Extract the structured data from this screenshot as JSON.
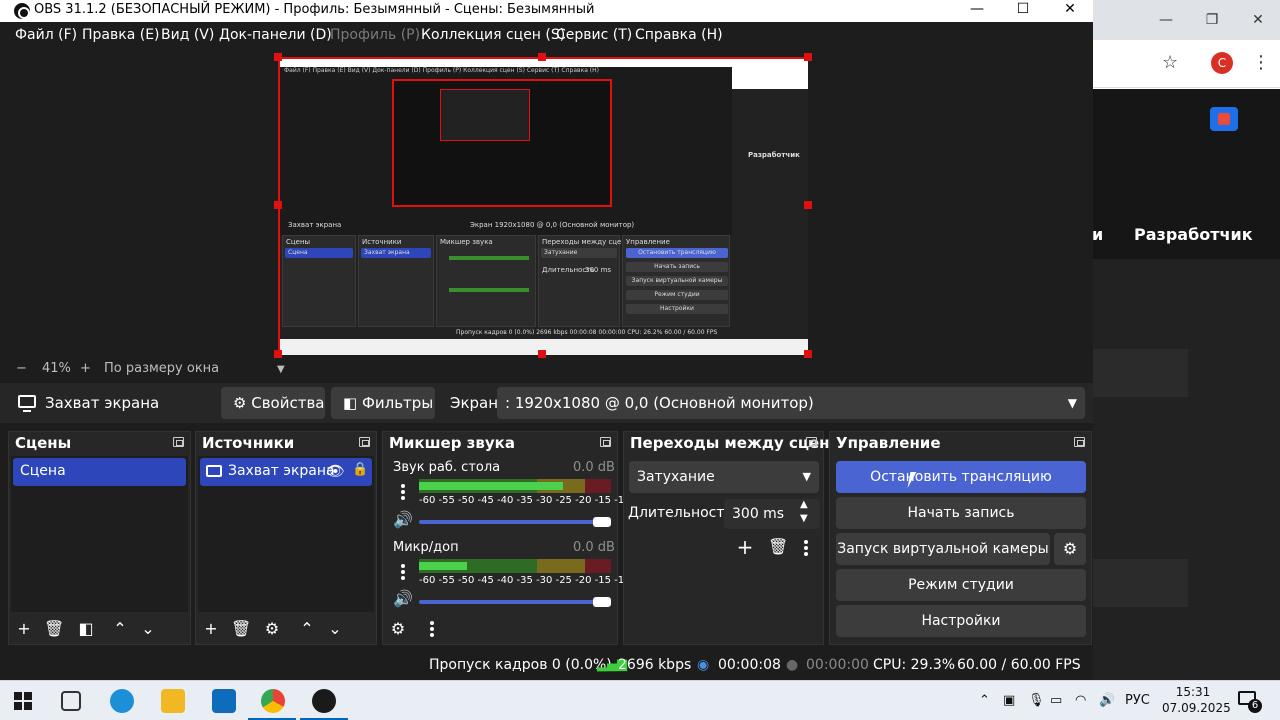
{
  "window": {
    "title": "OBS 31.1.2 (БЕЗОПАСНЫЙ РЕЖИМ) - Профиль: Безымянный - Сцены: Безымянный",
    "minimize": "—",
    "maximize": "☐",
    "close": "✕"
  },
  "menu": [
    {
      "label": "Файл (F)"
    },
    {
      "label": "Правка (E)"
    },
    {
      "label": "Вид (V)"
    },
    {
      "label": "Док-панели (D)"
    },
    {
      "label": "Профиль (P)"
    },
    {
      "label": "Коллекция сцен (S)"
    },
    {
      "label": "Сервис (T)"
    },
    {
      "label": "Справка (H)"
    }
  ],
  "preview": {
    "mini_menu": "Файл (F)  Правка (E)  Вид (V)  Док-панели (D)  Профиль (P)  Коллекция сцен (S)  Сервис (T)  Справка (H)",
    "mini_browser_text": "Разработчик",
    "mini_source": "Захват экрана",
    "mini_screen": "Экран   1920x1080 @ 0,0 (Основной монитор)",
    "mini_scenes": "Сцены",
    "mini_scene": "Сцена",
    "mini_sources": "Источники",
    "mini_mixer": "Микшер звука",
    "mini_transitions": "Переходы между сцен...",
    "mini_controls": "Управление",
    "mini_stop": "Остановить трансляцию",
    "mini_rec": "Начать запись",
    "mini_vcam": "Запуск виртуальной камеры",
    "mini_studio": "Режим студии",
    "mini_settings": "Настройки",
    "mini_fade": "Затухание",
    "mini_duration": "Длительность",
    "mini_ms": "300 ms",
    "mini_status": "Пропуск кадров 0 (0.0%)   2696 kbps   00:00:08   00:00:00   CPU: 26.2%   60.00 / 60.00 FPS"
  },
  "zoom": {
    "minus": "−",
    "value": "41%",
    "plus": "+",
    "fit": "По размеру окна",
    "arrow": "▼"
  },
  "source_toolbar": {
    "source_name": "Захват экрана",
    "properties": "Свойства",
    "filters": "Фильтры",
    "screen_label": "Экран",
    "screen_value": ": 1920x1080 @ 0,0 (Основной монитор)"
  },
  "scenes": {
    "title": "Сцены",
    "items": [
      "Сцена"
    ]
  },
  "sources": {
    "title": "Источники",
    "items": [
      "Захват экрана"
    ]
  },
  "mixer": {
    "title": "Микшер звука",
    "tracks": [
      {
        "name": "Звук раб. стола",
        "db": "0.0 dB",
        "level": 0.75
      },
      {
        "name": "Микр/доп",
        "db": "0.0 dB",
        "level": 0.25
      }
    ],
    "scale": "-60 -55 -50 -45 -40 -35 -30 -25 -20 -15 -10 -5  0"
  },
  "transitions": {
    "title": "Переходы между сцен...",
    "type": "Затухание",
    "duration_label": "Длительность",
    "duration": "300 ms"
  },
  "controls": {
    "title": "Управление",
    "stop_stream": "Остановить трансляцию",
    "start_record": "Начать запись",
    "virtual_camera": "Запуск виртуальной камеры",
    "studio_mode": "Режим студии",
    "settings": "Настройки"
  },
  "status": {
    "dropped": "Пропуск кадров 0 (0.0%)",
    "bitrate": "2696 kbps",
    "stream_time": "00:00:08",
    "rec_time": "00:00:00",
    "cpu": "CPU: 29.3%",
    "fps": "60.00 / 60.00 FPS"
  },
  "browser": {
    "nav_item_partial": "и",
    "nav_item": "Разработчик",
    "avatar_letter": "C"
  },
  "taskbar": {
    "lang": "РУС",
    "time": "15:31",
    "date": "07.09.2025",
    "notifications": "6"
  },
  "colors": {
    "accent": "#4a64d2",
    "selection": "#2d46b9",
    "preview_border": "#e01010"
  }
}
